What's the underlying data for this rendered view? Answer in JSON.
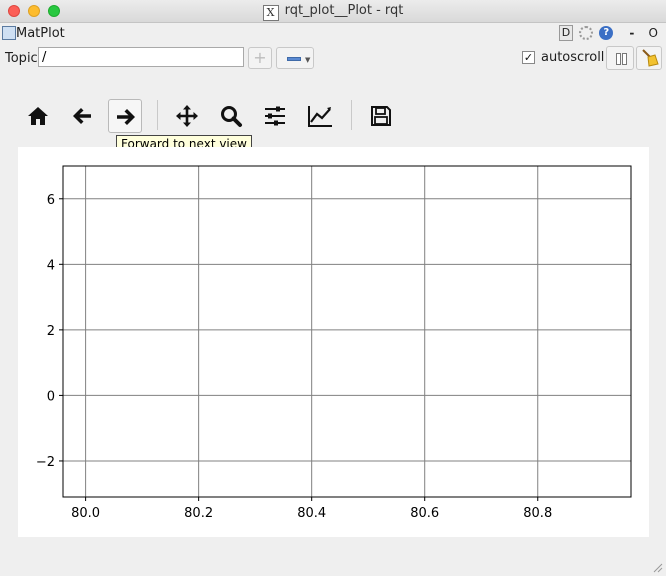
{
  "window": {
    "title": "rqt_plot__Plot - rqt"
  },
  "dock": {
    "title": "MatPlot",
    "button_d": "D",
    "button_help": "?",
    "button_minimize": "-",
    "button_close": "O"
  },
  "topic": {
    "label": "Topic",
    "value": "/",
    "add_symbol": "+",
    "autoscroll_label": "autoscroll",
    "autoscroll_checked": true
  },
  "toolbar": {
    "buttons": [
      "home-icon",
      "back-arrow-icon",
      "forward-arrow-icon",
      "pan-icon",
      "zoom-icon",
      "subplots-config-icon",
      "axis-edit-icon",
      "save-icon"
    ],
    "active": "forward-arrow-icon",
    "tooltip": "Forward to next view"
  },
  "chart_data": {
    "type": "line",
    "title": "",
    "xlabel": "",
    "ylabel": "",
    "xlim": [
      79.96,
      80.965
    ],
    "ylim": [
      -3.1,
      7.0
    ],
    "x_ticks": [
      "80.0",
      "80.2",
      "80.4",
      "80.6",
      "80.8"
    ],
    "x_tick_values": [
      80.0,
      80.2,
      80.4,
      80.6,
      80.8
    ],
    "y_ticks": [
      "6",
      "4",
      "2",
      "0",
      "−2"
    ],
    "y_tick_values": [
      6,
      4,
      2,
      0,
      -2
    ],
    "grid": true,
    "series": []
  }
}
